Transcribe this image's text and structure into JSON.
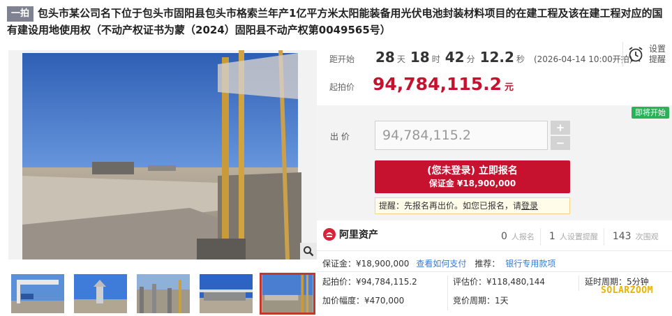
{
  "title": {
    "badge": "一拍",
    "text": "包头市某公司名下位于包头市固阳县包头市格索兰年产1亿平方米太阳能装备用光伏电池封装材料项目的在建工程及该在建工程对应的国有建设用地使用权（不动产权证书为蒙（2024）固阳县不动产权第0049565号）"
  },
  "countdown": {
    "label": "距开始",
    "days": "28",
    "days_unit": "天",
    "hours": "18",
    "hours_unit": "时",
    "minutes": "42",
    "minutes_unit": "分",
    "seconds": "12.2",
    "seconds_unit": "秒",
    "start_note": "(2026-04-14 10:00开拍)"
  },
  "reminder": {
    "label": "设置提醒",
    "icon": "alarm-clock-icon"
  },
  "start_price": {
    "label": "起拍价",
    "value": "94,784,115.2",
    "unit": "元"
  },
  "bid": {
    "status_badge": "即将开始",
    "label": "出 价",
    "input_value": "94,784,115.2",
    "plus": "+",
    "minus": "−",
    "signup_line1": "(您未登录) 立即报名",
    "signup_line2": "保证金 ¥18,900,000",
    "tip_prefix": "提醒：先报名再出价。如您已报名，请",
    "tip_link": "登录"
  },
  "platform": {
    "name": "阿里资产",
    "icon": "ali-asset-logo"
  },
  "stats": [
    {
      "num": "0",
      "label": "人报名"
    },
    {
      "num": "1",
      "label": "人设置提醒"
    },
    {
      "num": "143",
      "label": "次围观"
    }
  ],
  "info": {
    "deposit": "保证金：¥18,900,000",
    "pay_link": "查看如何支付",
    "recommend": "推荐：",
    "bank_link": "银行专用款项",
    "start_price": "起拍价：¥94,784,115.2",
    "appraisal": "评估价：¥118,480,144",
    "extension": "延时周期：5分钟",
    "increment": "加价幅度：¥470,000",
    "bid_period": "竞价周期：1天"
  },
  "watermark": "SOLARZOOM",
  "colors": {
    "accent_red": "#c7122f",
    "link_blue": "#3a7bd5",
    "badge_green": "#2bb15a",
    "watermark": "#e8b400"
  }
}
